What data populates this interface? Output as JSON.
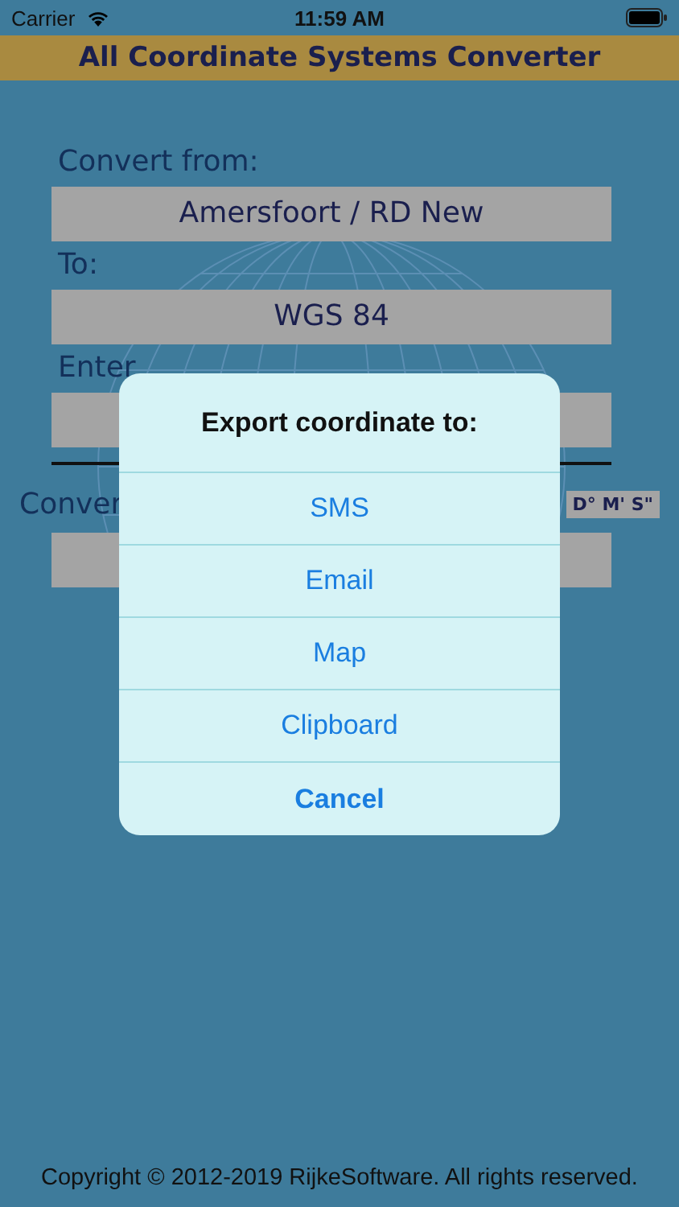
{
  "status_bar": {
    "carrier": "Carrier",
    "time": "11:59 AM"
  },
  "title_bar": {
    "title": "All Coordinate Systems Converter"
  },
  "form": {
    "from_label": "Convert from:",
    "from_value": "Amersfoort / RD New",
    "to_label": "To:",
    "to_value": "WGS 84",
    "enter_label": "Enter",
    "converted_label": "Conver",
    "format_button": "D° M' S\""
  },
  "dialog": {
    "title": "Export coordinate to:",
    "actions": [
      {
        "label": "SMS",
        "kind": "normal"
      },
      {
        "label": "Email",
        "kind": "normal"
      },
      {
        "label": "Map",
        "kind": "normal"
      },
      {
        "label": "Clipboard",
        "kind": "normal"
      },
      {
        "label": "Cancel",
        "kind": "cancel"
      }
    ]
  },
  "footer": {
    "copyright": "Copyright © 2012-2019 RijkeSoftware. All rights reserved."
  }
}
